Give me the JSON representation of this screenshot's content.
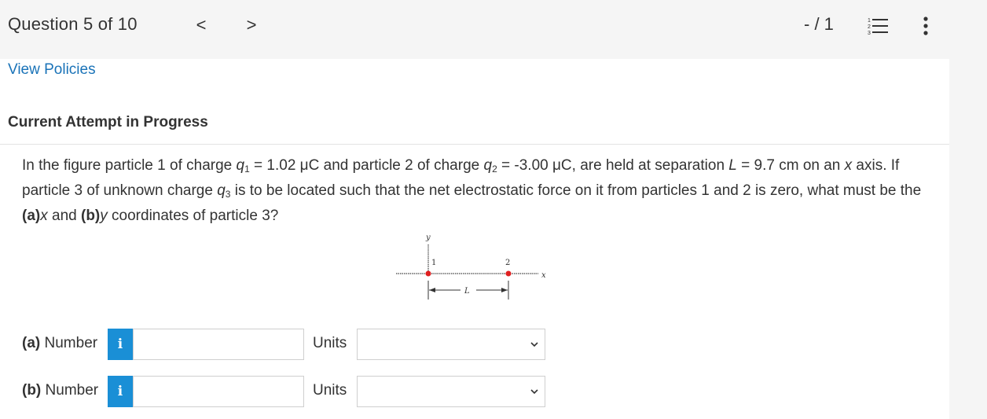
{
  "header": {
    "question_counter": "Question 5 of 10",
    "prev_label": "<",
    "next_label": ">",
    "score": "- / 1"
  },
  "links": {
    "view_policies": "View Policies"
  },
  "attempt_status": "Current Attempt in Progress",
  "question": {
    "p1": "In the figure particle 1 of charge ",
    "q1_sym": "q",
    "q1_sub": "1",
    "p2": " = 1.02 μC and particle 2 of charge ",
    "q2_sym": "q",
    "q2_sub": "2",
    "p3": " = -3.00 μC, are held at separation ",
    "L_sym": "L",
    "p4": " = 9.7 cm on an ",
    "x_sym": "x",
    "p5": " axis. If particle 3 of unknown charge ",
    "q3_sym": "q",
    "q3_sub": "3",
    "p6": " is to be located such that the net electrostatic force on it from particles 1 and 2 is zero, what must be the ",
    "a_part": "(a)",
    "a_var": "x",
    "p7": " and ",
    "b_part": "(b)",
    "b_var": "y",
    "p8": " coordinates of particle 3?"
  },
  "figure": {
    "y_label": "y",
    "x_label": "x",
    "p1_label": "1",
    "p2_label": "2",
    "L_label": "L"
  },
  "answers": [
    {
      "part": "(a)",
      "label": "Number",
      "info": "i",
      "value": "",
      "units_label": "Units",
      "units_value": ""
    },
    {
      "part": "(b)",
      "label": "Number",
      "info": "i",
      "value": "",
      "units_label": "Units",
      "units_value": ""
    }
  ],
  "colors": {
    "link": "#1a73b8",
    "info_button": "#1a8fd6",
    "particle": "#e02020"
  }
}
